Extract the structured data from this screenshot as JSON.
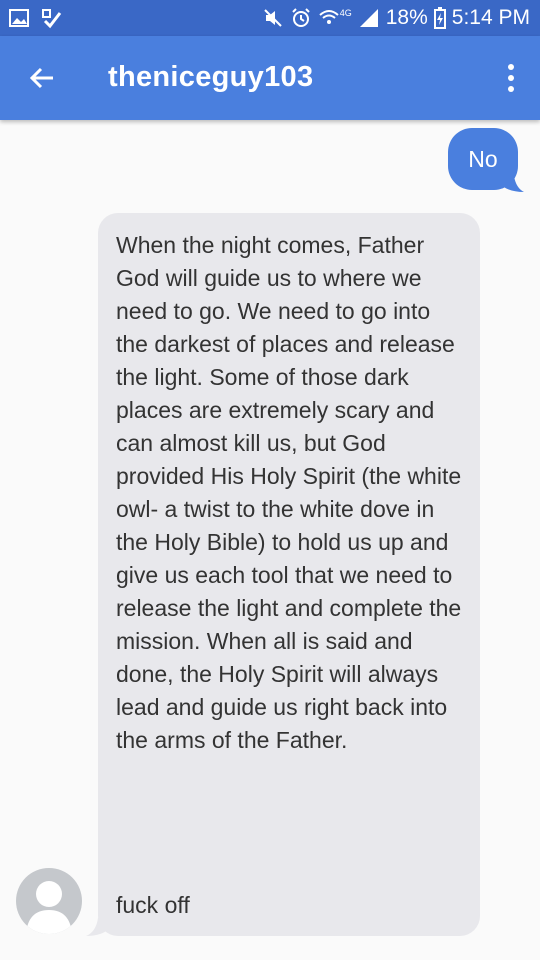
{
  "status_bar": {
    "network": "4G",
    "battery": "18%",
    "time": "5:14 PM",
    "icons": [
      "gallery-icon",
      "check-notification-icon",
      "mute-icon",
      "alarm-icon",
      "wifi-icon",
      "signal-icon",
      "battery-charging-icon"
    ]
  },
  "header": {
    "title": "theniceguy103",
    "back_icon": "arrow-back-icon",
    "menu_icon": "more-vert-icon"
  },
  "messages": [
    {
      "direction": "outgoing",
      "text": "No"
    },
    {
      "direction": "incoming",
      "text": "When the night comes, Father God will guide us to where we need to go. We need to go into the darkest of places and release the light. Some of those dark places are extremely scary and can almost kill us, but God provided His Holy Spirit (the white owl- a twist to the white dove in the Holy Bible) to hold us up and give us each tool that we need to release the light and complete the mission. When all is said and done, the Holy Spirit will always lead and guide us right back into the arms of the Father.",
      "text2": "fuck off"
    }
  ],
  "colors": {
    "status_bar": "#3a68c6",
    "app_bar": "#4a7fde",
    "outgoing_bubble": "#4a7fde",
    "incoming_bubble": "#e8e8ec"
  }
}
